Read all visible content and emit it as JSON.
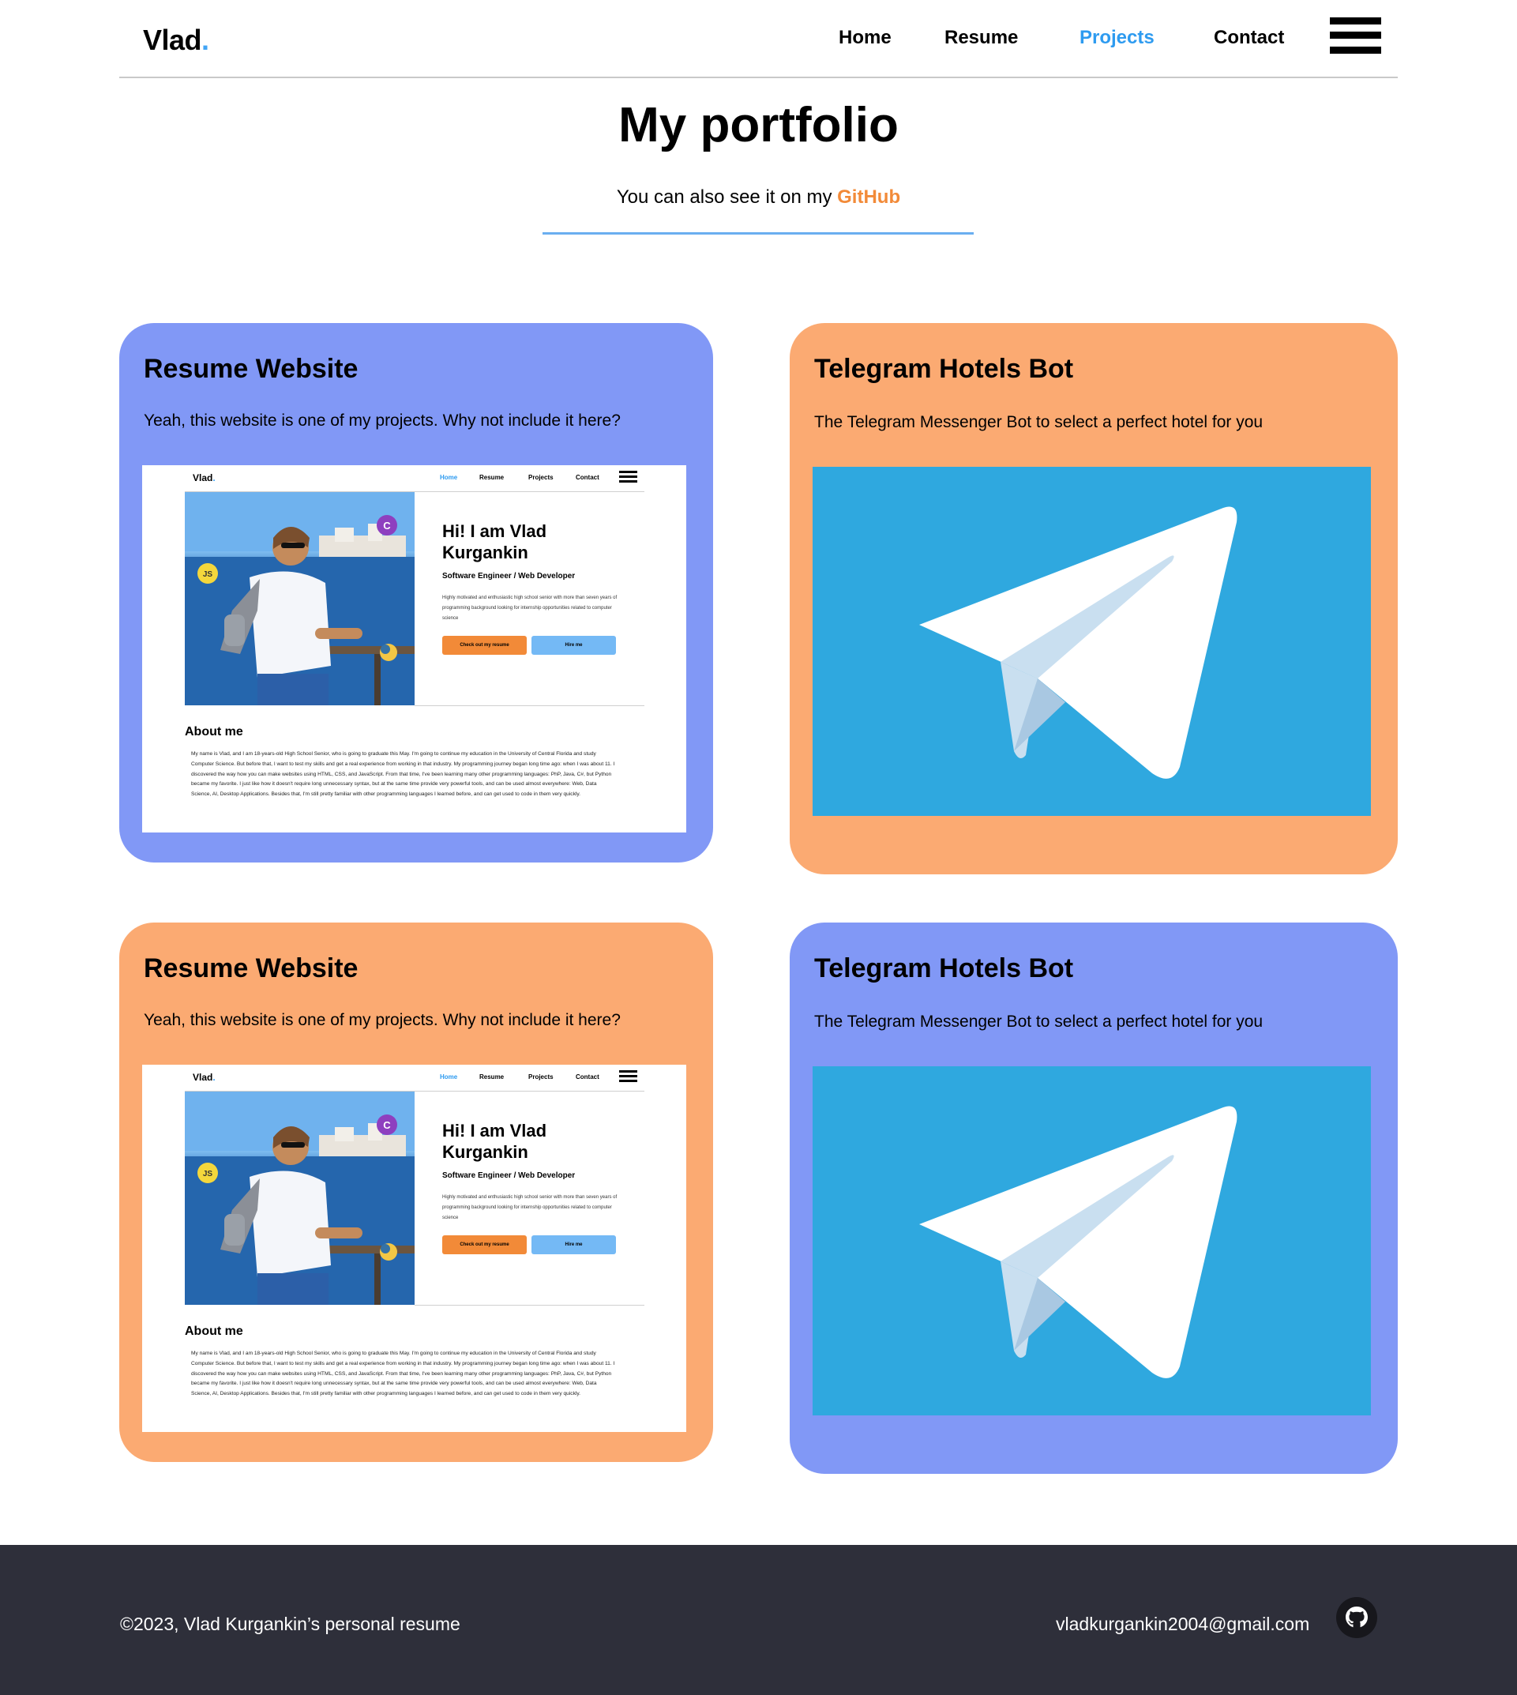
{
  "header": {
    "logo": "Vlad",
    "logo_dot": ".",
    "nav": [
      "Home",
      "Resume",
      "Projects",
      "Contact"
    ],
    "active_nav": "Projects",
    "menu_icon": "hamburger-menu-icon"
  },
  "main": {
    "title": "My portfolio",
    "subtitle_prefix": "You can also see it on my ",
    "github_link": "GitHub"
  },
  "projects": [
    {
      "title": "Resume Website",
      "description": "Yeah, this website is one of my projects. Why not include it here?",
      "color": "#8198f6",
      "image": "resume-website-screenshot"
    },
    {
      "title": "Telegram Hotels Bot",
      "description": "The Telegram Messenger Bot to select a perfect hotel for you",
      "color": "#fbaa72",
      "image": "telegram-logo"
    },
    {
      "title": "Resume Website",
      "description": "Yeah, this website is one of my projects. Why not include it here?",
      "color": "#fbaa72",
      "image": "resume-website-screenshot"
    },
    {
      "title": "Telegram Hotels Bot",
      "description": "The Telegram Messenger Bot to select a perfect hotel for you",
      "color": "#8198f6",
      "image": "telegram-logo"
    }
  ],
  "preview": {
    "logo": "Vlad",
    "logo_dot": ".",
    "nav": [
      "Home",
      "Resume",
      "Projects",
      "Contact"
    ],
    "heading": "Hi! I am Vlad Kurgankin",
    "role": "Software Engineer / Web Developer",
    "blurb": "Highly motivated and enthusiastic high school senior with more than seven years of programming background looking for internship opportunities related to computer science",
    "btn_resume": "Check out my resume",
    "btn_hire": "Hire me",
    "about_title": "About me",
    "about_text": "My name is Vlad, and I am 18-years-old High School Senior, who is going to graduate this May. I'm going to continue my education in the University of Central Florida and study Computer Science. But before that, I want to test my skills and get a real experience from working in that industry. My programming journey began long time ago: when I was about 11. I discovered the way how you can make websites using HTML, CSS, and JavaScript. From that time, I've been learning many other programming languages: PhP, Java, C#, but Python became my favorite. I just like how it doesn't require long unnecessary syntax, but at the same time provide very powerful tools, and can be used almost everywhere: Web, Data Science, AI, Desktop Applications. Besides that, I'm still pretty familiar with other programming languages I learned before, and can get used to code in them very quickly."
  },
  "footer": {
    "copyright": "©2023, Vlad Kurgankin’s personal resume",
    "email": "vladkurgankin2004@gmail.com",
    "github_icon": "github-icon"
  },
  "colors": {
    "accent_blue": "#2e9bf0",
    "accent_orange": "#f28a38",
    "card_blue": "#8198f6",
    "card_orange": "#fbaa72",
    "footer_bg": "#2e2f3a",
    "telegram_bg": "#2fa8df"
  }
}
